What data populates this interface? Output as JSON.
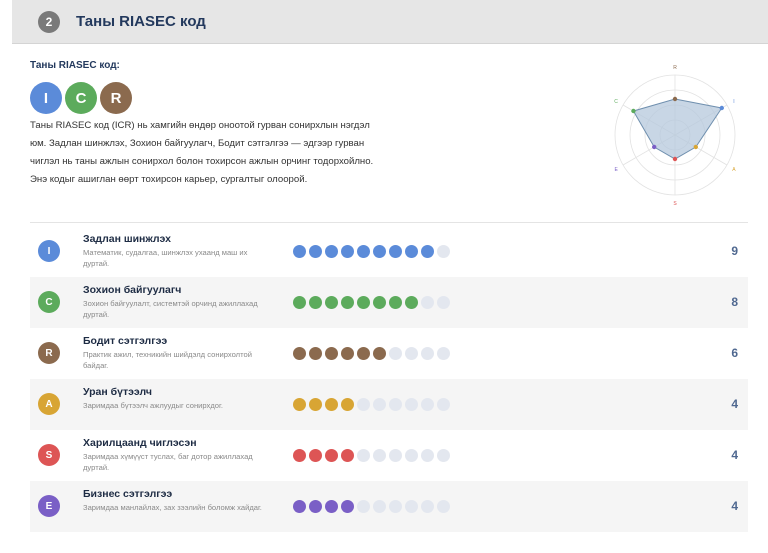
{
  "header": {
    "step": "2",
    "title": "Таны RIASEC код"
  },
  "code": {
    "title": "Таны RIASEC код:",
    "letters": [
      {
        "letter": "I",
        "color": "#5b8bd9"
      },
      {
        "letter": "C",
        "color": "#5cab5c"
      },
      {
        "letter": "R",
        "color": "#8b6a4e"
      }
    ],
    "description": "Таны RIASEC код (ICR) нь хамгийн өндөр оноотой гурван сонирхлын нэгдэл юм. Задлан шинжлэх, Зохион байгуулагч, Бодит сэтгэлгээ — эдгээр гурван чиглэл нь таны ажлын сонирхол болон тохирсон ажлын орчинг тодорхойлно. Энэ кодыг ашиглан өөрт тохирсон карьер, сургалтыг олоорой."
  },
  "radar": {
    "axes": [
      "R",
      "I",
      "A",
      "S",
      "E",
      "C"
    ],
    "max": 10,
    "fill_color": "#b6c8dc",
    "stroke_color": "#6f8fae"
  },
  "scores": [
    {
      "code": "I",
      "name": "Задлан шинжлэх",
      "desc": "Математик, судалгаа, шинжлэх ухаанд маш их дуртай.",
      "score": 9,
      "color": "#5b8bd9"
    },
    {
      "code": "C",
      "name": "Зохион байгуулагч",
      "desc": "Зохион байгуулалт, системтэй орчинд ажиллахад дуртай.",
      "score": 8,
      "color": "#5cab5c"
    },
    {
      "code": "R",
      "name": "Бодит сэтгэлгээ",
      "desc": "Практик ажил, техникийн шийдэлд сонирхолтой байдаг.",
      "score": 6,
      "color": "#8b6a4e"
    },
    {
      "code": "A",
      "name": "Уран бүтээлч",
      "desc": "Заримдаа бүтээлч ажлуудыг сонирхдог.",
      "score": 4,
      "color": "#d8a534"
    },
    {
      "code": "S",
      "name": "Харилцаанд чиглэсэн",
      "desc": "Заримдаа хүмүүст туслах, баг дотор ажиллахад дуртай.",
      "score": 4,
      "color": "#dd5555"
    },
    {
      "code": "E",
      "name": "Бизнес сэтгэлгээ",
      "desc": "Заримдаа манлайлах, зах зээлийн боломж хайдаг.",
      "score": 4,
      "color": "#7a5fc6"
    }
  ],
  "dots_total": 10
}
